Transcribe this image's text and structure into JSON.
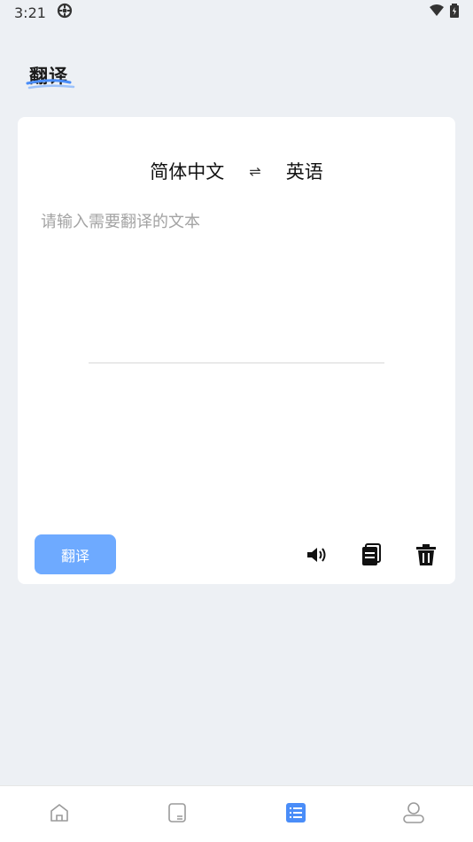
{
  "status": {
    "time": "3:21"
  },
  "page": {
    "title": "翻译"
  },
  "translator": {
    "source_lang": "简体中文",
    "swap_symbol": "⇌",
    "target_lang": "英语",
    "input_placeholder": "请输入需要翻译的文本",
    "input_value": "",
    "translate_label": "翻译"
  },
  "toolbar": {
    "icons": [
      "speaker-icon",
      "copy-icon",
      "trash-icon"
    ]
  },
  "tabbar": {
    "items": [
      {
        "icon": "home-icon",
        "active": false
      },
      {
        "icon": "document-icon",
        "active": false
      },
      {
        "icon": "list-icon",
        "active": true
      },
      {
        "icon": "profile-icon",
        "active": false
      }
    ],
    "active_color": "#4a8df8",
    "inactive_color": "#9a9a9a"
  },
  "colors": {
    "accent": "#6eaaff",
    "background": "#edf0f4"
  }
}
